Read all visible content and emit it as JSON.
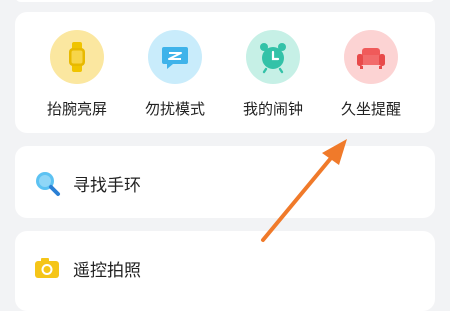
{
  "functions": [
    {
      "label": "抬腕亮屏",
      "icon": "watch-icon",
      "color": "#fbe7a0"
    },
    {
      "label": "勿扰模式",
      "icon": "message-icon",
      "color": "#c9ecfb"
    },
    {
      "label": "我的闹钟",
      "icon": "alarm-clock-icon",
      "color": "#c6f0e6"
    },
    {
      "label": "久坐提醒",
      "icon": "sofa-icon",
      "color": "#fcd3d3"
    }
  ],
  "list": [
    {
      "label": "寻找手环",
      "icon": "search-icon"
    },
    {
      "label": "遥控拍照",
      "icon": "camera-icon"
    }
  ],
  "annotation_color": "#f07a2a"
}
